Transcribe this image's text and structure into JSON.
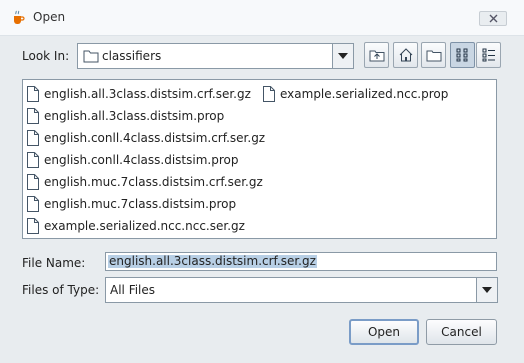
{
  "window": {
    "title": "Open"
  },
  "look_in": {
    "label": "Look In:",
    "folder": "classifiers"
  },
  "files": [
    "english.all.3class.distsim.crf.ser.gz",
    "english.all.3class.distsim.prop",
    "english.conll.4class.distsim.crf.ser.gz",
    "english.conll.4class.distsim.prop",
    "english.muc.7class.distsim.crf.ser.gz",
    "english.muc.7class.distsim.prop",
    "example.serialized.ncc.ncc.ser.gz",
    "example.serialized.ncc.prop"
  ],
  "file_name": {
    "label": "File Name:",
    "value": "english.all.3class.distsim.crf.ser.gz"
  },
  "files_of_type": {
    "label": "Files of Type:",
    "value": "All Files"
  },
  "buttons": {
    "open": "Open",
    "cancel": "Cancel"
  },
  "icons": {
    "app": "java-coffee-icon",
    "close": "close-x-icon",
    "folder": "folder-icon",
    "up_one_level": "up-folder-icon",
    "home": "home-icon",
    "new_folder": "new-folder-icon",
    "list_view": "list-view-icon",
    "details_view": "details-view-icon",
    "file": "file-icon"
  },
  "colors": {
    "selection": "#b8cfe5",
    "default_button_border": "#7a9cc7"
  }
}
